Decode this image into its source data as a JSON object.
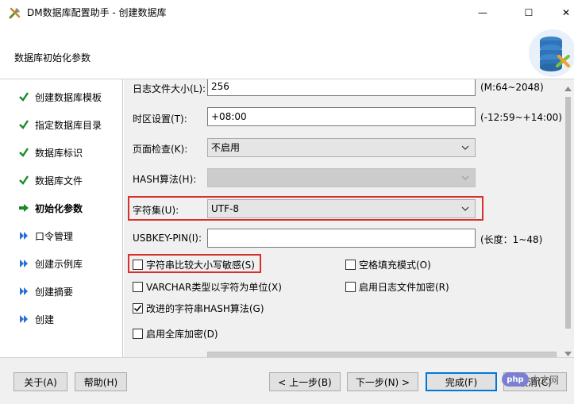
{
  "window": {
    "title": "DM数据库配置助手 - 创建数据库",
    "minimize": "—",
    "maximize": "☐",
    "close": "✕"
  },
  "header": {
    "title": "数据库初始化参数"
  },
  "nav": {
    "items": [
      {
        "label": "创建数据库模板",
        "state": "done"
      },
      {
        "label": "指定数据库目录",
        "state": "done"
      },
      {
        "label": "数据库标识",
        "state": "done"
      },
      {
        "label": "数据库文件",
        "state": "done"
      },
      {
        "label": "初始化参数",
        "state": "current"
      },
      {
        "label": "口令管理",
        "state": "pending"
      },
      {
        "label": "创建示例库",
        "state": "pending"
      },
      {
        "label": "创建摘要",
        "state": "pending"
      },
      {
        "label": "创建",
        "state": "pending"
      }
    ]
  },
  "form": {
    "log_size_label": "日志文件大小(L):",
    "log_size_value": "256",
    "log_size_hint": "(M:64~2048)",
    "timezone_label": "时区设置(T):",
    "timezone_value": "+08:00",
    "timezone_hint": "(-12:59~+14:00)",
    "page_check_label": "页面检查(K):",
    "page_check_value": "不启用",
    "hash_label": "HASH算法(H):",
    "hash_value": "",
    "charset_label": "字符集(U):",
    "charset_value": "UTF-8",
    "usbkey_label": "USBKEY-PIN(I):",
    "usbkey_value": "",
    "usbkey_hint": "(长度：1~48)",
    "case_sensitive_label": "字符串比较大小写敏感(S)",
    "blank_pad_label": "空格填充模式(O)",
    "varchar_label": "VARCHAR类型以字符为单位(X)",
    "log_encrypt_label": "启用日志文件加密(R)",
    "improved_hash_label": "改进的字符串HASH算法(G)",
    "full_encrypt_label": "启用全库加密(D)"
  },
  "checkboxes": {
    "case_sensitive": false,
    "blank_pad": false,
    "varchar": false,
    "log_encrypt": false,
    "improved_hash": true,
    "full_encrypt": false
  },
  "footer": {
    "about": "关于(A)",
    "help": "帮助(H)",
    "prev": "< 上一步(B)",
    "next": "下一步(N) >",
    "finish": "完成(F)",
    "cancel": "取消(C)"
  },
  "watermark": {
    "logo": "php",
    "text": "中文网"
  },
  "colors": {
    "highlight": "#d9302b",
    "check_green": "#1a8a2a",
    "arrow_blue": "#2a6fd6"
  }
}
